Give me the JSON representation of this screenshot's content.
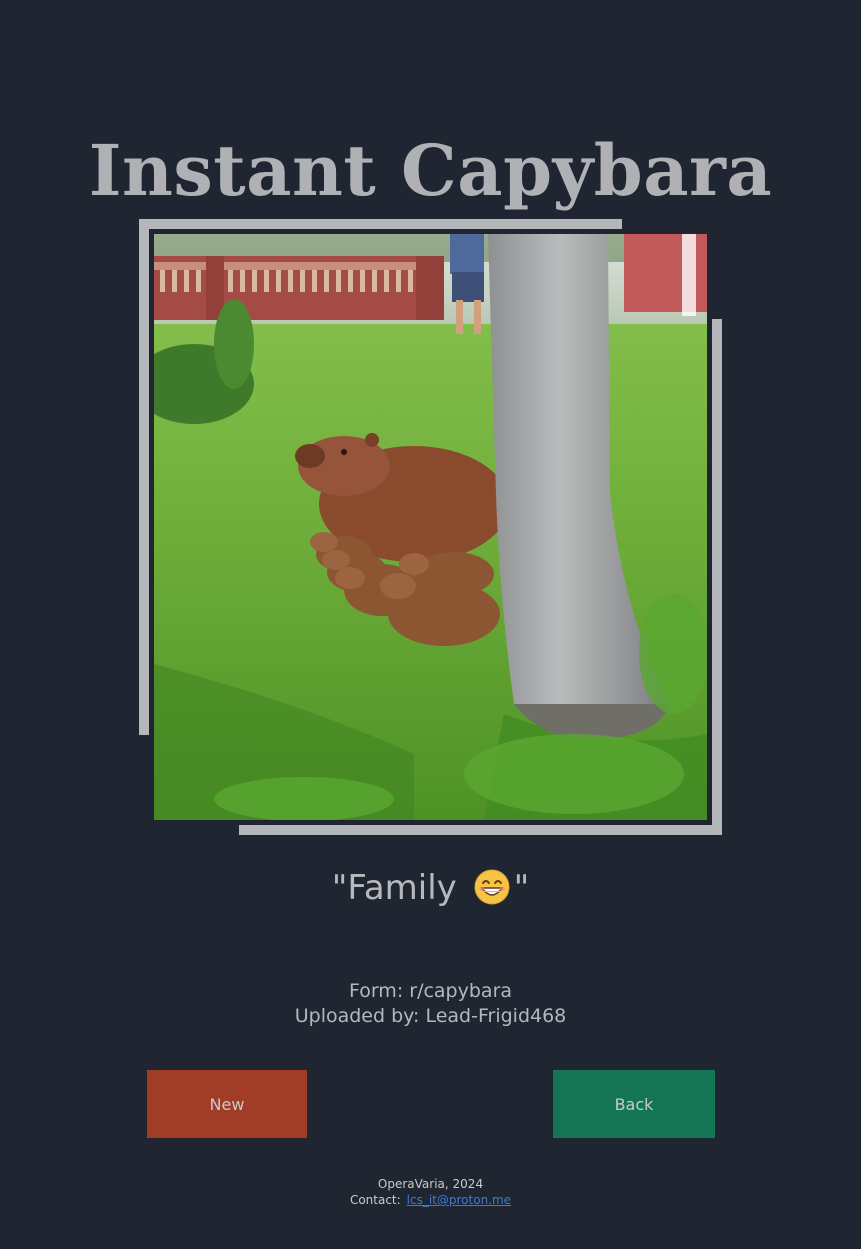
{
  "page": {
    "title": "Instant Capybara"
  },
  "post": {
    "caption_open": "\"Family ",
    "caption_close": "\"",
    "caption_emoji": "grinning-face-with-smiling-eyes",
    "source_label": "Form: r/capybara",
    "uploader_label": "Uploaded by: Lead-Frigid468"
  },
  "buttons": {
    "new_label": "New",
    "back_label": "Back"
  },
  "footer": {
    "credit": "OperaVaria, 2024",
    "contact_label": "Contact:",
    "contact_email": "lcs_it@proton.me"
  },
  "colors": {
    "background": "#1f2631",
    "title": "#b0b1b5",
    "frame": "#b5b6ba",
    "new_button": "#a13d26",
    "back_button": "#137553",
    "link": "#3a7bd5"
  }
}
